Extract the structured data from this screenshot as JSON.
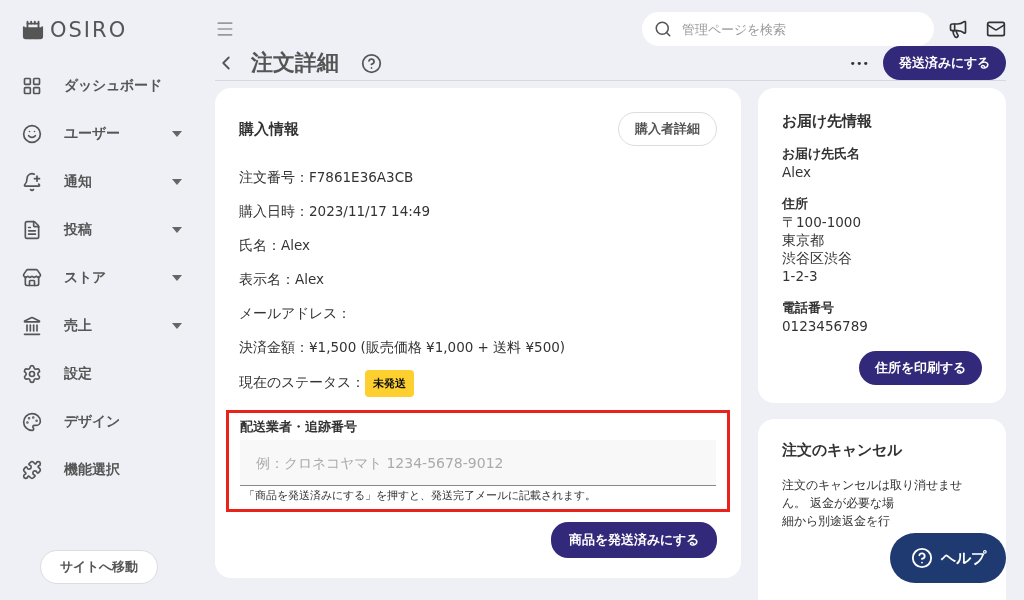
{
  "brand": {
    "name": "OSIRO"
  },
  "sidebar": {
    "items": [
      {
        "label": "ダッシュボード",
        "expandable": false
      },
      {
        "label": "ユーザー",
        "expandable": true
      },
      {
        "label": "通知",
        "expandable": true
      },
      {
        "label": "投稿",
        "expandable": true
      },
      {
        "label": "ストア",
        "expandable": true
      },
      {
        "label": "売上",
        "expandable": true
      },
      {
        "label": "設定",
        "expandable": false
      },
      {
        "label": "デザイン",
        "expandable": false
      },
      {
        "label": "機能選択",
        "expandable": false
      }
    ],
    "site_button": "サイトへ移動"
  },
  "search": {
    "placeholder": "管理ページを検索"
  },
  "page": {
    "title": "注文詳細",
    "more": "•••",
    "primary_button": "発送済みにする"
  },
  "purchase": {
    "title": "購入情報",
    "detail_button": "購入者詳細",
    "fields": [
      "注文番号：F7861E36A3CB",
      "購入日時：2023/11/17 14:49",
      "氏名：Alex",
      "表示名：Alex",
      "メールアドレス：",
      "決済金額：¥1,500 (販売価格 ¥1,000 + 送料 ¥500)"
    ],
    "status_label": "現在のステータス：",
    "status": "未発送",
    "tracking": {
      "label": "配送業者・追跡番号",
      "placeholder": "例：クロネコヤマト 1234-5678-9012",
      "hint": "「商品を発送済みにする」を押すと、発送完了メールに記載されます。",
      "highlighted": true
    },
    "ship_button": "商品を発送済みにする"
  },
  "delivery": {
    "title": "お届け先情報",
    "sections": [
      {
        "label": "お届け先氏名",
        "lines": [
          "Alex"
        ]
      },
      {
        "label": "住所",
        "lines": [
          "〒100-1000",
          "東京都",
          "渋谷区渋谷",
          "1-2-3"
        ]
      },
      {
        "label": "電話番号",
        "lines": [
          "0123456789"
        ]
      }
    ],
    "print_button": "住所を印刷する"
  },
  "cancel": {
    "title": "注文のキャンセル",
    "lines": [
      "注文のキャンセルは取り消せませ",
      "ん。 返金が必要な場",
      "細から別途返金を行"
    ]
  },
  "help_button": "ヘルプ"
}
